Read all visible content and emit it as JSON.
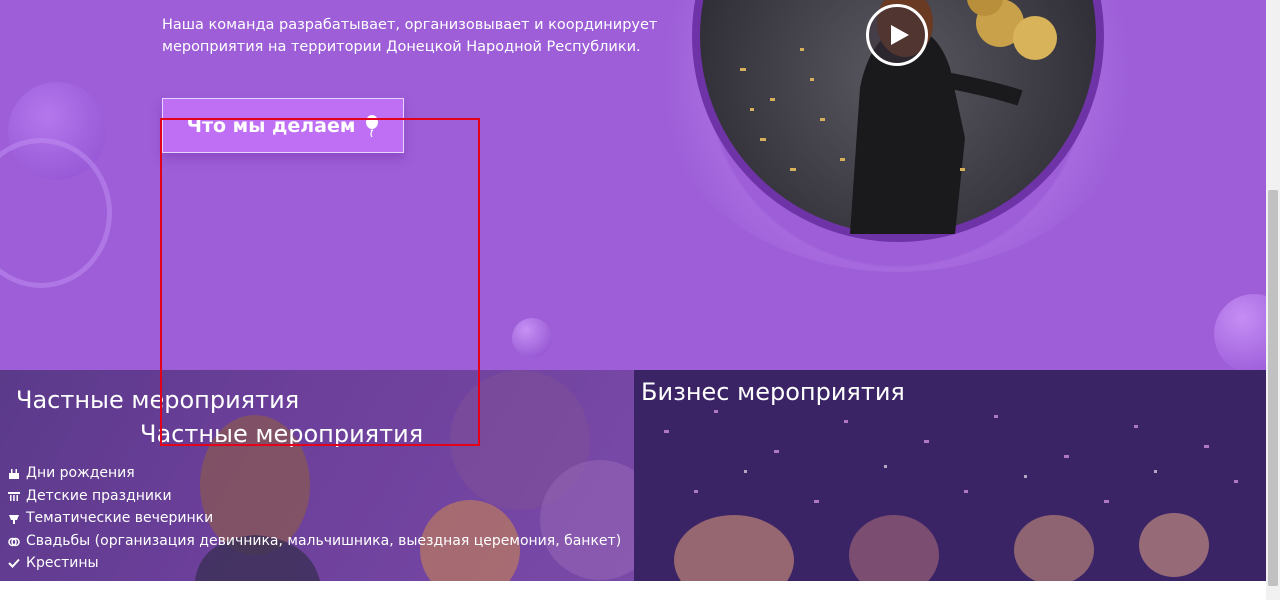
{
  "hero": {
    "intro_line1": "Наша команда разрабатывает, организовывает и координирует",
    "intro_line2": "мероприятия на территории Донецкой Народной Республики.",
    "cta_label": "Что мы делаем",
    "cta_icon": "balloon-icon",
    "play_icon": "play-icon"
  },
  "private": {
    "title": "Частные мероприятия",
    "title_duplicate": "Частные мероприятия",
    "items": [
      {
        "label": "Дни рождения",
        "icon": "cake-icon"
      },
      {
        "label": "Детские праздники",
        "icon": "birthday-candles-icon"
      },
      {
        "label": "Тематические вечеринки",
        "icon": "party-icon"
      },
      {
        "label": "Свадьбы (организация девичника, мальчишника, выездная церемония, банкет)",
        "icon": "rings-icon"
      },
      {
        "label": "Крестины",
        "icon": "check-icon"
      }
    ]
  },
  "business": {
    "title": "Бизнес мероприятия"
  },
  "colors": {
    "hero_bg": "#9d5ed7",
    "cta_bg": "#bf6ff3",
    "highlight_box": "#e3001b"
  }
}
